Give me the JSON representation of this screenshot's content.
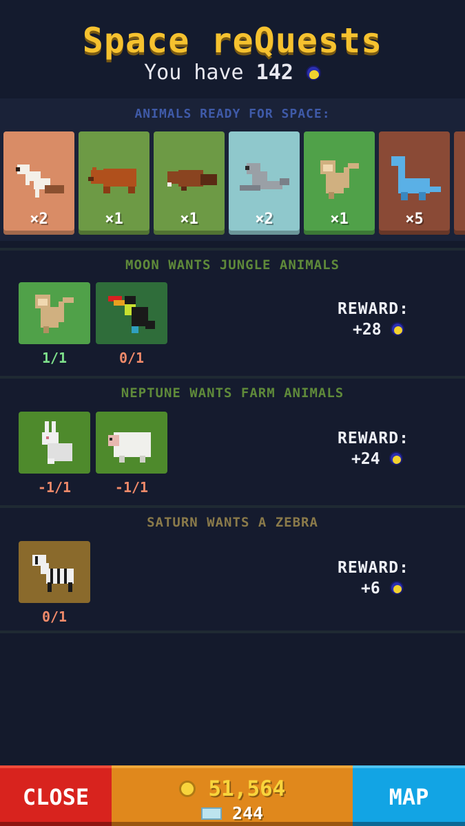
{
  "header": {
    "title": "Space reQuests",
    "you_have_label": "You have",
    "moon_balance": "142"
  },
  "ready": {
    "label": "ANIMALS READY FOR SPACE:",
    "cards": [
      {
        "animal": "weasel",
        "count": "×2",
        "color": "#d98c66"
      },
      {
        "animal": "bear",
        "count": "×1",
        "color": "#6d9a45"
      },
      {
        "animal": "beaver",
        "count": "×1",
        "color": "#6d9a45"
      },
      {
        "animal": "seal",
        "count": "×2",
        "color": "#8fc8cc"
      },
      {
        "animal": "monkey",
        "count": "×1",
        "color": "#50a149"
      },
      {
        "animal": "dinosaur",
        "count": "×5",
        "color": "#8a4a36"
      }
    ]
  },
  "requests": [
    {
      "title": "MOON WANTS JUNGLE ANIMALS",
      "title_color": "#5f8a3a",
      "slots": [
        {
          "animal": "monkey",
          "count": "1/1",
          "count_color": "#7ee08b",
          "color": "#50a149"
        },
        {
          "animal": "toucan",
          "count": "0/1",
          "count_color": "#f08a6a",
          "color": "#2f6d3a"
        }
      ],
      "reward_label": "REWARD:",
      "reward_value": "+28"
    },
    {
      "title": "NEPTUNE WANTS FARM ANIMALS",
      "title_color": "#5f8a3a",
      "slots": [
        {
          "animal": "rabbit",
          "count": "-1/1",
          "count_color": "#f08a6a",
          "color": "#4e8a2c"
        },
        {
          "animal": "sheep",
          "count": "-1/1",
          "count_color": "#f08a6a",
          "color": "#4e8a2c"
        }
      ],
      "reward_label": "REWARD:",
      "reward_value": "+24"
    },
    {
      "title": "SATURN WANTS A ZEBRA",
      "title_color": "#8a7a4a",
      "slots": [
        {
          "animal": "zebra",
          "count": "0/1",
          "count_color": "#f08a6a",
          "color": "#8a6a2c"
        }
      ],
      "reward_label": "REWARD:",
      "reward_value": "+6"
    }
  ],
  "footer": {
    "close_label": "CLOSE",
    "gold": "51,564",
    "gems": "244",
    "map_label": "MAP"
  },
  "icons": [
    "moon-coin-icon",
    "gold-coin-icon",
    "gem-icon"
  ]
}
